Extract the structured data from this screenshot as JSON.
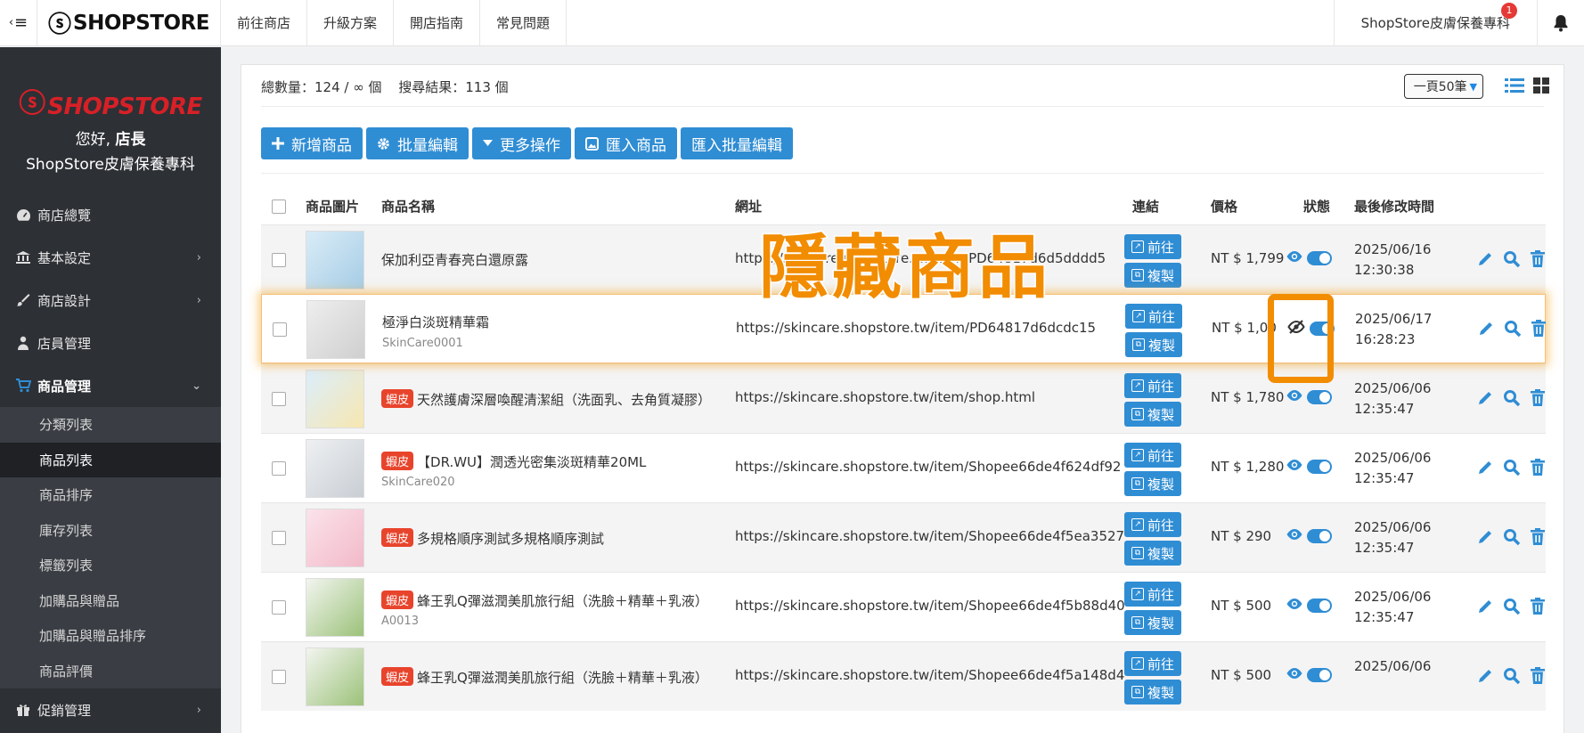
{
  "topbar": {
    "brand": "SHOPSTORE",
    "nav": [
      "前往商店",
      "升級方案",
      "開店指南",
      "常見問題"
    ],
    "store_name": "ShopStore皮膚保養專科",
    "notification_count": "1"
  },
  "sidebar": {
    "brand": "SHOPSTORE",
    "greeting_prefix": "您好,",
    "greeting_role": "店長",
    "store_name": "ShopStore皮膚保養專科",
    "items": [
      {
        "label": "商店總覽",
        "icon": "dashboard-icon"
      },
      {
        "label": "基本設定",
        "icon": "bank-icon"
      },
      {
        "label": "商店設計",
        "icon": "brush-icon"
      },
      {
        "label": "店員管理",
        "icon": "users-icon"
      },
      {
        "label": "商品管理",
        "icon": "cart-icon"
      },
      {
        "label": "促銷管理",
        "icon": "gift-icon"
      }
    ],
    "sub_items": [
      "分類列表",
      "商品列表",
      "商品排序",
      "庫存列表",
      "標籤列表",
      "加購品與贈品",
      "加購品與贈品排序",
      "商品評價"
    ]
  },
  "content": {
    "total_count": "總數量：124 / ∞ 個",
    "search_result": "搜尋結果：113 個",
    "per_page": "一頁50筆",
    "toolbar": {
      "add": "新增商品",
      "batch_edit": "批量編輯",
      "more": "更多操作",
      "import": "匯入商品",
      "import_batch": "匯入批量編輯"
    },
    "columns": {
      "image": "商品圖片",
      "name": "商品名稱",
      "url": "網址",
      "link": "連結",
      "price": "價格",
      "status": "狀態",
      "modified": "最後修改時間"
    },
    "go_label": "前往",
    "copy_label": "複製",
    "shopee_tag": "蝦皮",
    "rows": [
      {
        "name": "保加利亞青春亮白還原露",
        "sku": "",
        "tag": false,
        "url": "https://skincare.shopstore.tw/item/PD64817d6d5dddd5",
        "price": "NT $ 1,799",
        "date": "2025/06/16",
        "time": "12:30:38",
        "visible": true
      },
      {
        "name": "極淨白淡斑精華霜",
        "sku": "SkinCare0001",
        "tag": false,
        "url": "https://skincare.shopstore.tw/item/PD64817d6dcdc15",
        "price": "NT $ 1,00",
        "date": "2025/06/17",
        "time": "16:28:23",
        "visible": false
      },
      {
        "name": "天然護膚深層喚醒清潔組（洗面乳、去角質凝膠）",
        "sku": "",
        "tag": true,
        "url": "https://skincare.shopstore.tw/item/shop.html",
        "price": "NT $ 1,780",
        "date": "2025/06/06",
        "time": "12:35:47",
        "visible": true
      },
      {
        "name": "【DR.WU】潤透光密集淡斑精華20ML",
        "sku": "SkinCare020",
        "tag": true,
        "url": "https://skincare.shopstore.tw/item/Shopee66de4f624df92",
        "price": "NT $ 1,280",
        "date": "2025/06/06",
        "time": "12:35:47",
        "visible": true
      },
      {
        "name": "多規格順序測試多規格順序測試",
        "sku": "",
        "tag": true,
        "url": "https://skincare.shopstore.tw/item/Shopee66de4f5ea3527",
        "price": "NT $ 290",
        "date": "2025/06/06",
        "time": "12:35:47",
        "visible": true
      },
      {
        "name": "蜂王乳Q彈滋潤美肌旅行組（洗臉＋精華＋乳液）",
        "sku": "A0013",
        "tag": true,
        "url": "https://skincare.shopstore.tw/item/Shopee66de4f5b88d40",
        "price": "NT $ 500",
        "date": "2025/06/06",
        "time": "12:35:47",
        "visible": true
      },
      {
        "name": "蜂王乳Q彈滋潤美肌旅行組（洗臉＋精華＋乳液）",
        "sku": "",
        "tag": true,
        "url": "https://skincare.shopstore.tw/item/Shopee66de4f5a148d4",
        "price": "NT $ 500",
        "date": "2025/06/06",
        "time": "",
        "visible": true
      }
    ]
  },
  "overlay_title": "隱藏商品",
  "colors": {
    "primary": "#2f8dd4",
    "accent": "#f28c00",
    "shopee": "#e8442c",
    "brand_red": "#d72027"
  }
}
